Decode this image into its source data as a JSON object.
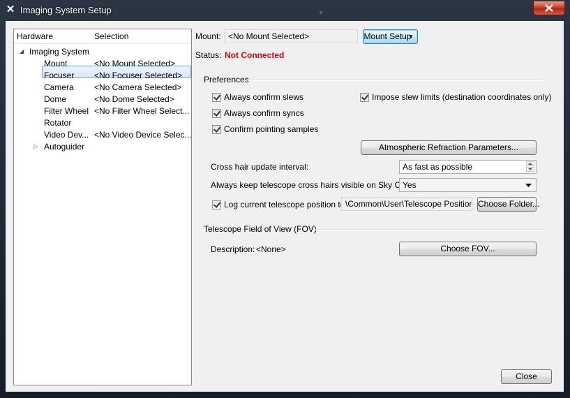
{
  "window": {
    "title": "Imaging System Setup"
  },
  "tree": {
    "columns": {
      "hardware": "Hardware",
      "selection": "Selection"
    },
    "root": "Imaging System",
    "items": [
      {
        "name": "Mount",
        "value": "<No Mount Selected>"
      },
      {
        "name": "Focuser",
        "value": "<No Focuser Selected>"
      },
      {
        "name": "Camera",
        "value": "<No Camera Selected>"
      },
      {
        "name": "Dome",
        "value": "<No Dome Selected>"
      },
      {
        "name": "Filter Wheel",
        "value": "<No Filter Wheel Select..."
      },
      {
        "name": "Rotator",
        "value": ""
      },
      {
        "name": "Video Dev...",
        "value": "<No Video Device Selec..."
      }
    ],
    "autoguider": "Autoguider"
  },
  "mount": {
    "label": "Mount:",
    "value": "<No Mount Selected>",
    "setup_button": "Mount Setup"
  },
  "status": {
    "label": "Status:",
    "value": "Not Connected",
    "color": "#e00000"
  },
  "preferences": {
    "title": "Preferences",
    "always_confirm_slews": "Always confirm slews",
    "always_confirm_syncs": "Always confirm syncs",
    "confirm_pointing": "Confirm pointing samples",
    "impose_slew_limits": "Impose slew limits (destination coordinates only)",
    "refraction_button": "Atmospheric Refraction Parameters...",
    "crosshair_label": "Cross hair update interval:",
    "crosshair_value": "As fast as possible",
    "keep_visible_label": "Always keep telescope cross hairs visible on Sky Chart:",
    "keep_visible_value": "Yes",
    "log_label": "Log current telescope position to:",
    "log_path": "\\Common\\User\\Telescope Position.txt",
    "choose_folder_button": "Choose Folder..."
  },
  "fov": {
    "title": "Telescope Field of View (FOV)",
    "description_label": "Description:",
    "description_value": "<None>",
    "choose_button": "Choose FOV..."
  },
  "close_button": "Close",
  "colors": {
    "selection_border": "#7da2ce",
    "focus_border": "#3c7fb1"
  }
}
